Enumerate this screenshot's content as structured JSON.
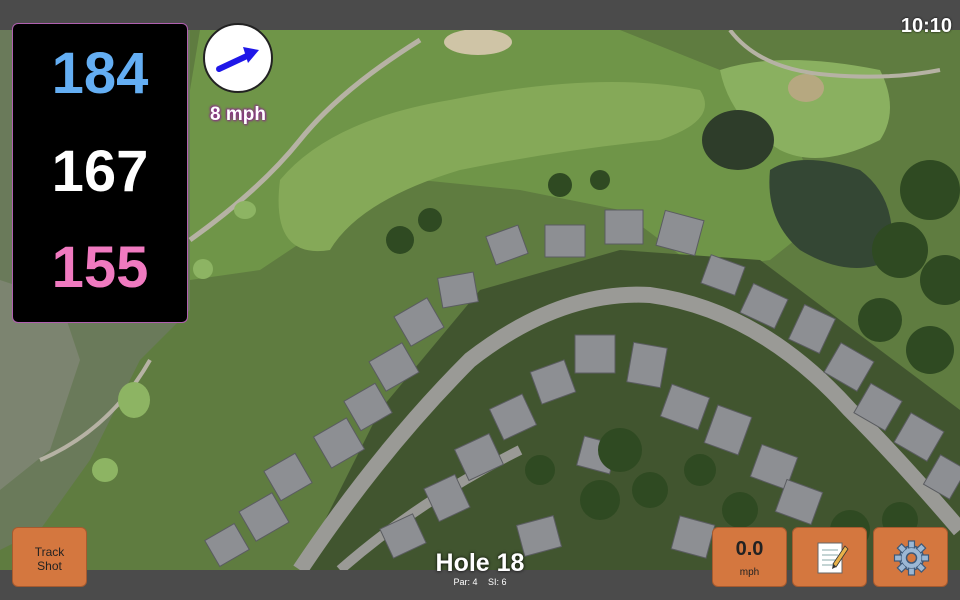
{
  "clock": {
    "time": "10:10"
  },
  "yardages": {
    "back": "184",
    "middle": "167",
    "front": "155"
  },
  "wind": {
    "speed": "8 mph",
    "direction_icon": "arrow-right-icon"
  },
  "track_button": {
    "line1": "Track",
    "line2": "Shot"
  },
  "hole": {
    "title": "Hole 18",
    "par": "Par: 4",
    "si": "SI: 6"
  },
  "speed_button": {
    "value": "0.0",
    "unit": "mph"
  },
  "notes_button": {
    "icon": "notepad-icon"
  },
  "settings_button": {
    "icon": "gear-icon"
  },
  "colors": {
    "back": "#64aef3",
    "middle": "#ffffff",
    "front": "#f07ac0",
    "button": "#d4773f",
    "wind_arrow": "#1f17e8"
  }
}
